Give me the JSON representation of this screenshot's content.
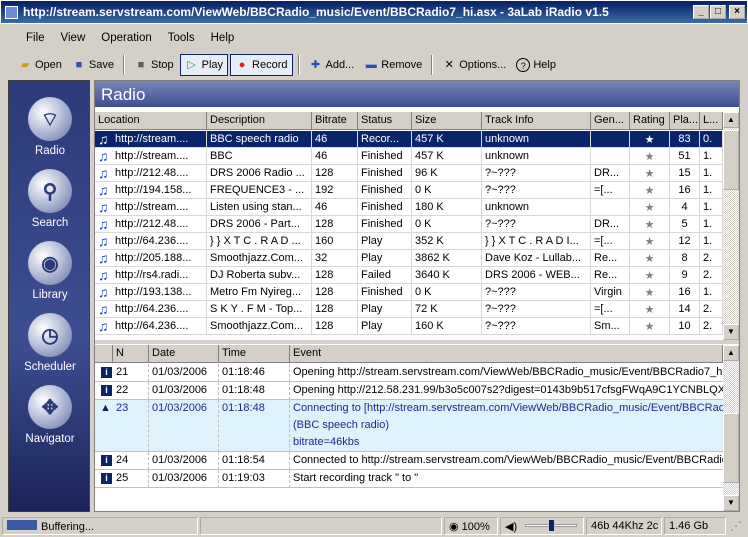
{
  "window": {
    "title": "http://stream.servstream.com/ViewWeb/BBCRadio_music/Event/BBCRadio7_hi.asx - 3aLab iRadio v1.5"
  },
  "menu": [
    "File",
    "View",
    "Operation",
    "Tools",
    "Help"
  ],
  "toolbar": {
    "open": "Open",
    "save": "Save",
    "stop": "Stop",
    "play": "Play",
    "record": "Record",
    "add": "Add...",
    "remove": "Remove",
    "options": "Options...",
    "help": "Help"
  },
  "sidebar": [
    {
      "label": "Radio",
      "icon": "radio-antenna-icon"
    },
    {
      "label": "Search",
      "icon": "magnifier-icon"
    },
    {
      "label": "Library",
      "icon": "speaker-cd-icon"
    },
    {
      "label": "Scheduler",
      "icon": "clock-icon"
    },
    {
      "label": "Navigator",
      "icon": "arrows-icon"
    }
  ],
  "panel": {
    "title": "Radio"
  },
  "stations": {
    "columns": [
      "Location",
      "Description",
      "Bitrate",
      "Status",
      "Size",
      "Track Info",
      "Gen...",
      "Rating",
      "Pla...",
      "L..."
    ],
    "rows": [
      [
        "http://stream....",
        "BBC speech radio",
        "46",
        "Recor...",
        "457 K",
        "unknown",
        "",
        "★",
        "83",
        "0."
      ],
      [
        "http://stream....",
        "BBC",
        "46",
        "Finished",
        "457 K",
        "unknown",
        "",
        "★",
        "51",
        "1."
      ],
      [
        "http://212.48....",
        "DRS 2006 Radio ...",
        "128",
        "Finished",
        "96 K",
        "?~???",
        "DR...",
        "★",
        "15",
        "1."
      ],
      [
        "http://194.158...",
        "FREQUENCE3 - ...",
        "192",
        "Finished",
        "0 K",
        "?~???",
        "=[...",
        "★",
        "16",
        "1."
      ],
      [
        "http://stream....",
        "Listen using stan...",
        "46",
        "Finished",
        "180 K",
        "unknown",
        "",
        "★",
        "4",
        "1."
      ],
      [
        "http://212.48....",
        "DRS 2006 - Part...",
        "128",
        "Finished",
        "0 K",
        "?~???",
        "DR...",
        "★",
        "5",
        "1."
      ],
      [
        "http://64.236....",
        "} } X T C . R A D ...",
        "160",
        "Play",
        "352 K",
        "} } X T C . R A D I...",
        "=[...",
        "★",
        "12",
        "1."
      ],
      [
        "http://205.188...",
        "Smoothjazz.Com...",
        "32",
        "Play",
        "3862 K",
        "Dave Koz - Lullab...",
        "Re...",
        "★",
        "8",
        "2."
      ],
      [
        "http://rs4.radi...",
        "DJ Roberta subv...",
        "128",
        "Failed",
        "3640 K",
        "DRS 2006 - WEB...",
        "Re...",
        "★",
        "9",
        "2."
      ],
      [
        "http://193.138...",
        "Metro Fm Nyireg...",
        "128",
        "Finished",
        "0 K",
        "?~???",
        "Virgin",
        "★",
        "16",
        "1."
      ],
      [
        "http://64.236....",
        "S K Y . F M - Top...",
        "128",
        "Play",
        "72 K",
        "?~???",
        "=[...",
        "★",
        "14",
        "2."
      ],
      [
        "http://64.236....",
        "Smoothjazz.Com...",
        "128",
        "Play",
        "160 K",
        "?~???",
        "Sm...",
        "★",
        "10",
        "2."
      ]
    ],
    "selected_index": 0
  },
  "log": {
    "columns": [
      "N",
      "Date",
      "Time",
      "Event"
    ],
    "rows": [
      {
        "type": "info",
        "n": "21",
        "date": "01/03/2006",
        "time": "01:18:46",
        "event": [
          "Opening http://stream.servstream.com/ViewWeb/BBCRadio_music/Event/BBCRadio7_hi.a"
        ]
      },
      {
        "type": "info",
        "n": "22",
        "date": "01/03/2006",
        "time": "01:18:48",
        "event": [
          "Opening http://212.58.231.99/b3o5c007s2?digest=0143b9b517cfsgFWqA9C1YCNBLQXp"
        ]
      },
      {
        "type": "warning",
        "n": "23",
        "date": "01/03/2006",
        "time": "01:18:48",
        "event": [
          "Connecting to [http://stream.servstream.com/ViewWeb/BBCRadio_music/Event/BBCRadio",
          "(BBC speech radio)",
          "bitrate=46kbs"
        ]
      },
      {
        "type": "info",
        "n": "24",
        "date": "01/03/2006",
        "time": "01:18:54",
        "event": [
          "Connected to http://stream.servstream.com/ViewWeb/BBCRadio_music/Event/BBCRadio7"
        ]
      },
      {
        "type": "info",
        "n": "25",
        "date": "01/03/2006",
        "time": "01:19:03",
        "event": [
          "Start recording track \" to \""
        ]
      }
    ]
  },
  "status": {
    "state": "Buffering...",
    "zoom": "100%",
    "volume_percent": 50,
    "format": "46b 44Khz 2c",
    "disk": "1.46 Gb"
  }
}
